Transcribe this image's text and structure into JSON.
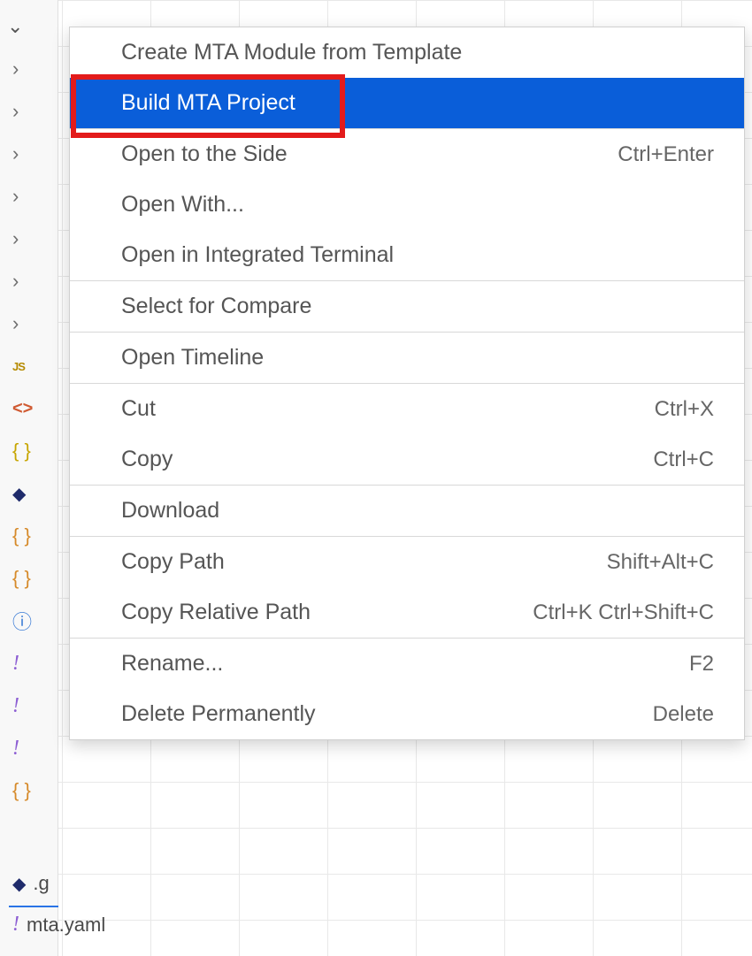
{
  "menu": {
    "createModule": "Create MTA Module from Template",
    "buildMta": "Build MTA Project",
    "openSide": "Open to the Side",
    "openSideKey": "Ctrl+Enter",
    "openWith": "Open With...",
    "openTerminal": "Open in Integrated Terminal",
    "selectCompare": "Select for Compare",
    "openTimeline": "Open Timeline",
    "cut": "Cut",
    "cutKey": "Ctrl+X",
    "copy": "Copy",
    "copyKey": "Ctrl+C",
    "download": "Download",
    "copyPath": "Copy Path",
    "copyPathKey": "Shift+Alt+C",
    "copyRelPath": "Copy Relative Path",
    "copyRelPathKey": "Ctrl+K Ctrl+Shift+C",
    "rename": "Rename...",
    "renameKey": "F2",
    "delete": "Delete Permanently",
    "deleteKey": "Delete"
  },
  "gutter": {
    "js": "JS",
    "xml": "<>",
    "brace": "{ }",
    "bang": "!",
    "diamond": "◆",
    "info": "ⓘ",
    "chev": "›",
    "down": "⌄"
  },
  "files": {
    "git": ".g",
    "mta": "mta.yaml"
  }
}
